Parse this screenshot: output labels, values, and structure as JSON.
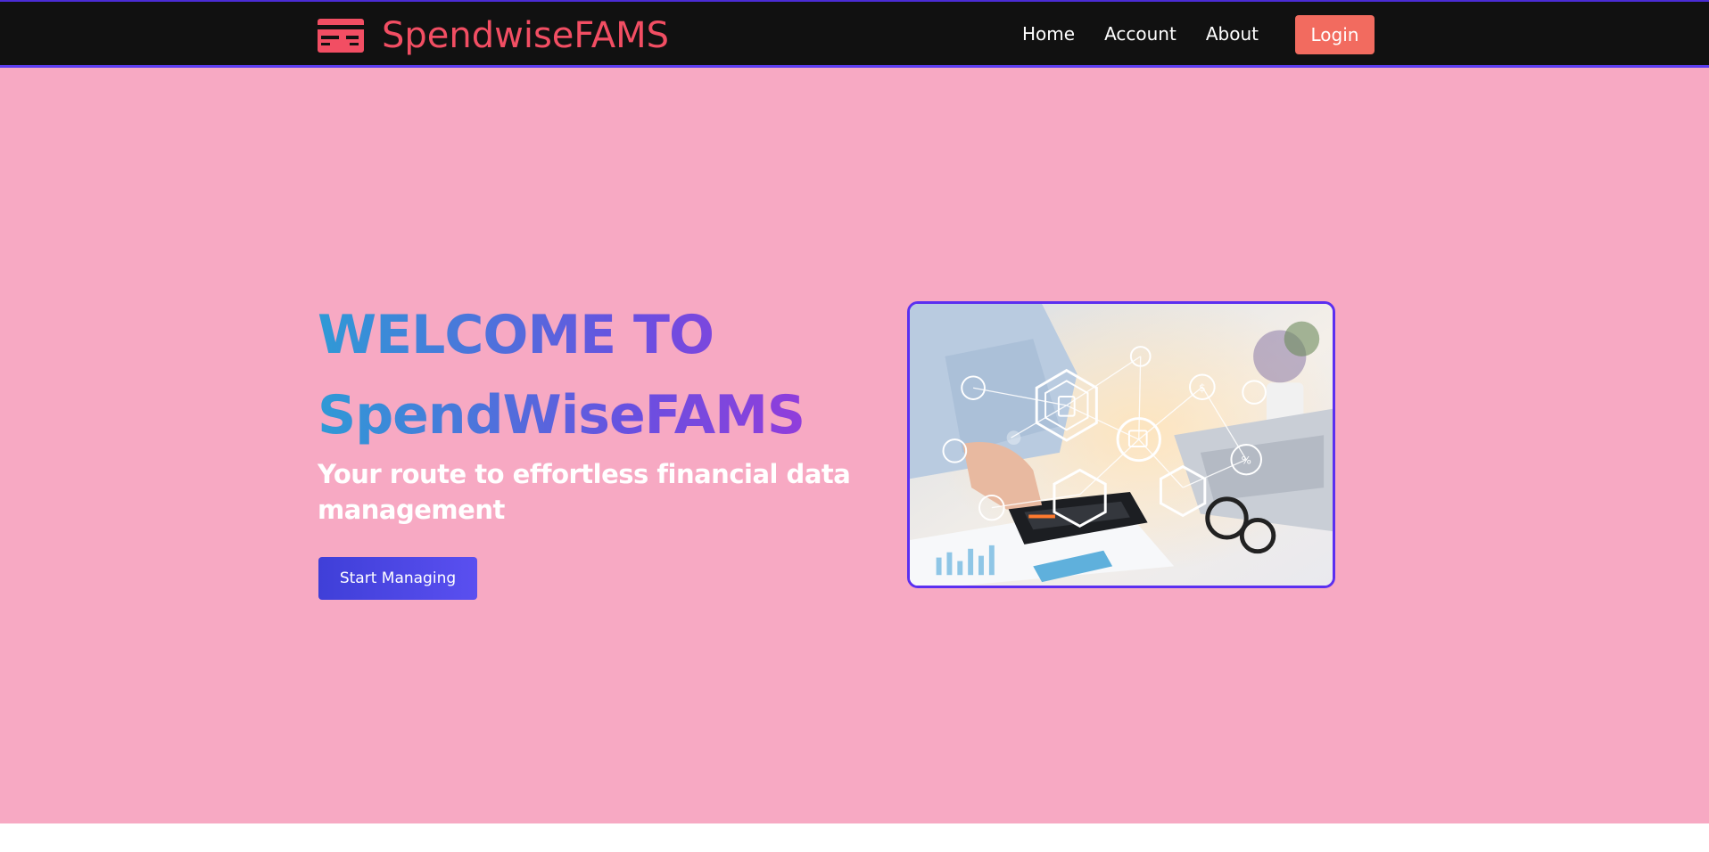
{
  "brand": {
    "name": "SpendwiseFAMS",
    "color": "#f24e63"
  },
  "nav": {
    "items": [
      {
        "label": "Home"
      },
      {
        "label": "Account"
      },
      {
        "label": "About"
      }
    ],
    "login_label": "Login"
  },
  "hero": {
    "title_line1": "WELCOME TO",
    "title_line2": "SpendWiseFAMS",
    "subtitle": "Your route to effortless financial data management",
    "cta_label": "Start Managing",
    "background": "#f7a9c3",
    "image_alt": "Person using a calculator with financial network icons overlay"
  },
  "colors": {
    "navbar": "#111111",
    "accent_border": "#5b3df0",
    "login": "#f26b5f",
    "cta": "#4545e0"
  }
}
